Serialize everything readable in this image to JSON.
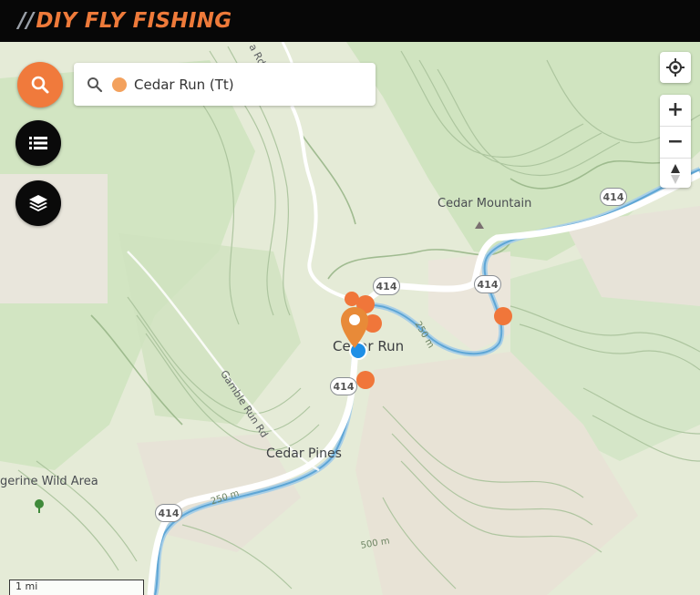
{
  "header": {
    "brand_slash": "//",
    "brand": "DIY FLY FISHING"
  },
  "search": {
    "value": "Cedar Run (Tt)"
  },
  "colors": {
    "accent": "#f07a3c",
    "spot": "#f0763a",
    "current_location": "#1e8fe6",
    "header_bg": "#070707"
  },
  "icons": {
    "search_button": "search-icon",
    "list_button": "list-icon",
    "layers_button": "layers-icon",
    "locate": "crosshair-icon",
    "zoom_in": "plus-icon",
    "zoom_out": "minus-icon",
    "compass": "compass-icon"
  },
  "controls": {
    "zoom_in": "+",
    "zoom_out": "−"
  },
  "map": {
    "places": {
      "cedar_run": "Cedar Run",
      "cedar_mountain": "Cedar Mountain",
      "cedar_pines": "Cedar Pines",
      "wild_area": "gerine Wild Area"
    },
    "roads": {
      "gamble_run": "Gamble Run Rd",
      "top_road": "a Rd"
    },
    "route_shields": [
      "414",
      "414",
      "414",
      "414",
      "414"
    ],
    "contours": [
      "250 m",
      "250 m",
      "500 m"
    ],
    "scale": "1 mi"
  }
}
